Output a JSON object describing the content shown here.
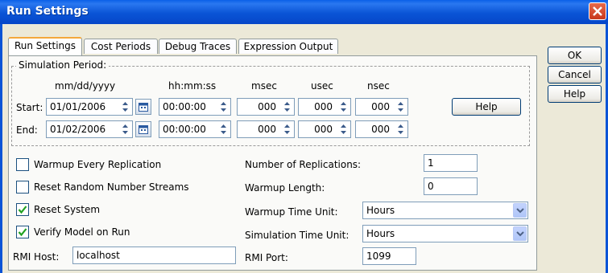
{
  "window": {
    "title": "Run Settings"
  },
  "tabs": [
    {
      "label": "Run Settings",
      "active": true
    },
    {
      "label": "Cost Periods",
      "active": false
    },
    {
      "label": "Debug Traces",
      "active": false
    },
    {
      "label": "Expression Output",
      "active": false
    }
  ],
  "side_buttons": {
    "ok": "OK",
    "cancel": "Cancel",
    "help": "Help"
  },
  "simulation_period": {
    "label": "Simulation Period:",
    "headers": {
      "date": "mm/dd/yyyy",
      "time": "hh:mm:ss",
      "msec": "msec",
      "usec": "usec",
      "nsec": "nsec"
    },
    "start": {
      "label": "Start:",
      "date": "01/01/2006",
      "time": "00:00:00",
      "msec": "000",
      "usec": "000",
      "nsec": "000"
    },
    "end": {
      "label": "End:",
      "date": "01/02/2006",
      "time": "00:00:00",
      "msec": "000",
      "usec": "000",
      "nsec": "000"
    },
    "help_button": "Help"
  },
  "options": {
    "warmup_every_replication": {
      "label": "Warmup Every Replication",
      "checked": false
    },
    "reset_random_streams": {
      "label": "Reset Random Number Streams",
      "checked": false
    },
    "reset_system": {
      "label": "Reset System",
      "checked": true
    },
    "verify_model": {
      "label": "Verify Model on Run",
      "checked": true
    }
  },
  "settings": {
    "replications": {
      "label": "Number of Replications:",
      "value": "1"
    },
    "warmup_length": {
      "label": "Warmup Length:",
      "value": "0"
    },
    "warmup_time_unit": {
      "label": "Warmup Time Unit:",
      "value": "Hours"
    },
    "sim_time_unit": {
      "label": "Simulation Time Unit:",
      "value": "Hours"
    },
    "rmi_host": {
      "label": "RMI Host:",
      "value": "localhost"
    },
    "rmi_port": {
      "label": "RMI Port:",
      "value": "1099"
    }
  },
  "icons": {
    "close": "close-icon",
    "spinner": "spinner-icon",
    "calendar": "calendar-icon",
    "check": "checkmark-icon",
    "dropdown": "chevron-down-icon"
  },
  "colors": {
    "titlebar": "#0a54d6",
    "dialog_bg": "#ece9d8",
    "active_tab_accent": "#f4a83c",
    "checkmark": "#21a121"
  }
}
